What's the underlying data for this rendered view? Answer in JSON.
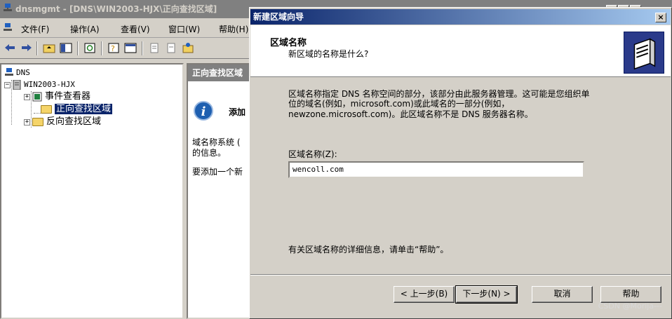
{
  "mmc": {
    "title": "dnsmgmt - [DNS\\WIN2003-HJX\\正向查找区域]",
    "menu": [
      "文件(F)",
      "操作(A)",
      "查看(V)",
      "窗口(W)",
      "帮助(H)"
    ],
    "tree": {
      "root": "DNS",
      "server": "WIN2003-HJX",
      "items": [
        "事件查看器",
        "正向查找区域",
        "反向查找区域"
      ]
    },
    "right_pane": {
      "header": "正向查找区域",
      "heading": "添加",
      "line1": "域名称系统 (",
      "line2": "的信息。",
      "line3": "要添加一个新"
    }
  },
  "wizard": {
    "title": "新建区域向导",
    "close_label": "×",
    "header_title": "区域名称",
    "header_subtitle": "新区域的名称是什么?",
    "desc_line1": "区域名称指定 DNS 名称空间的部分，该部分由此服务器管理。这可能是您组织单",
    "desc_line2": "位的域名(例如，microsoft.com)或此域名的一部分(例如，",
    "desc_line3": "newzone.microsoft.com)。此区域名称不是 DNS 服务器名称。",
    "field_label": "区域名称(Z):",
    "field_value": "wencoll.com",
    "help_text": "有关区域名称的详细信息，请单击“帮助”。",
    "buttons": {
      "back": "< 上一步(B)",
      "next": "下一步(N) >",
      "cancel": "取消",
      "help": "帮助"
    }
  },
  "watermark": "CSDN @Morija---",
  "colors": {
    "title_active": "#0a246a",
    "title_inactive": "#808080",
    "face": "#d4d0c8"
  }
}
